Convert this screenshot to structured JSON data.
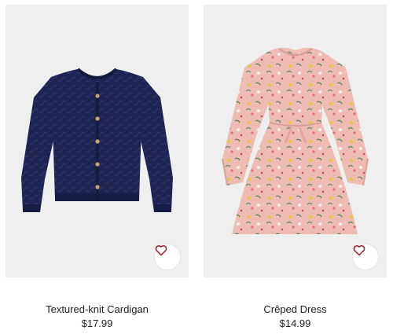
{
  "products": [
    {
      "name": "Textured-knit Cardigan",
      "price": "$17.99",
      "image_icon": "cardigan-image",
      "favorite_icon": "heart-outline-icon",
      "garment_color": "#1d2452"
    },
    {
      "name": "Crêped Dress",
      "price": "$14.99",
      "image_icon": "floral-dress-image",
      "favorite_icon": "heart-outline-icon",
      "garment_color": "#eebcb3"
    }
  ],
  "colors": {
    "image_background": "#efefef",
    "heart": "#9b1d2e",
    "text": "#222222"
  }
}
